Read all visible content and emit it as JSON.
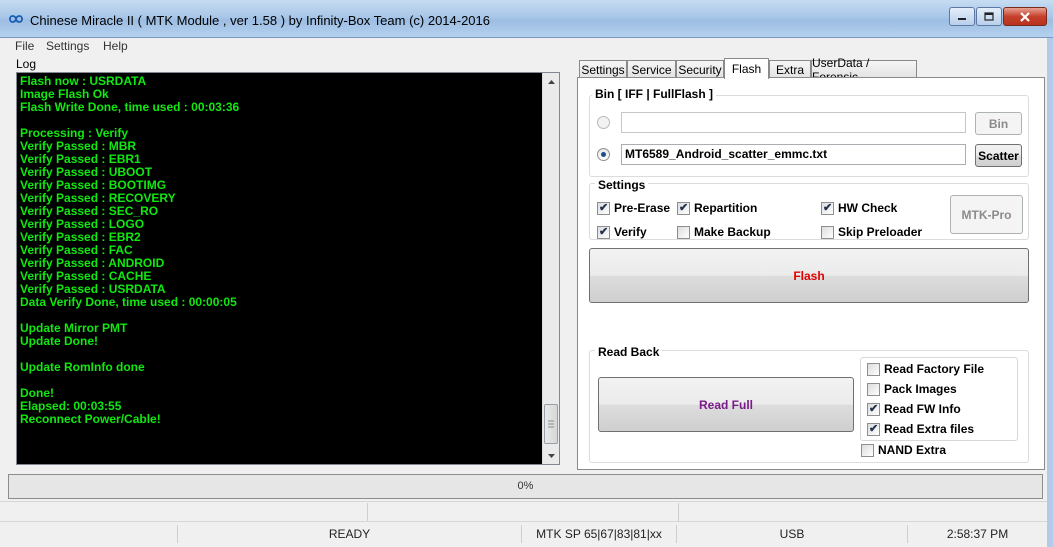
{
  "window": {
    "title": "Chinese Miracle II ( MTK Module , ver 1.58 ) by Infinity-Box Team (c) 2014-2016",
    "icon": "infinity-logo-icon"
  },
  "menu": [
    "File",
    "Settings",
    "Help"
  ],
  "log": {
    "label": "Log",
    "lines": [
      "Flash now : USRDATA",
      "Image Flash Ok",
      "Flash Write Done, time used : 00:03:36",
      "",
      "Processing : Verify",
      "Verify Passed : MBR",
      "Verify Passed : EBR1",
      "Verify Passed : UBOOT",
      "Verify Passed : BOOTIMG",
      "Verify Passed : RECOVERY",
      "Verify Passed : SEC_RO",
      "Verify Passed : LOGO",
      "Verify Passed : EBR2",
      "Verify Passed : FAC",
      "Verify Passed : ANDROID",
      "Verify Passed : CACHE",
      "Verify Passed : USRDATA",
      "Data Verify Done, time used : 00:00:05",
      "",
      "Update Mirror PMT",
      "Update Done!",
      "",
      "Update RomInfo done",
      "",
      "Done!",
      "Elapsed: 00:03:55",
      "Reconnect Power/Cable!"
    ]
  },
  "tabs": [
    "Settings",
    "Service",
    "Security",
    "Flash",
    "Extra",
    "UserData / Forensic"
  ],
  "active_tab": "Flash",
  "bin": {
    "title": "Bin  [ IFF | FullFlash ]",
    "bin_value": "",
    "bin_button": "Bin",
    "scatter_value": "MT6589_Android_scatter_emmc.txt",
    "scatter_button": "Scatter"
  },
  "settings": {
    "title": "Settings",
    "pre_erase": "Pre-Erase",
    "repartition": "Repartition",
    "hw_check": "HW Check",
    "verify": "Verify",
    "make_backup": "Make Backup",
    "skip_preloader": "Skip Preloader",
    "mtk_pro": "MTK-Pro"
  },
  "flash_button": "Flash",
  "readback": {
    "title": "Read Back",
    "read_full": "Read Full",
    "read_factory_file": "Read Factory File",
    "pack_images": "Pack Images",
    "read_fw_info": "Read FW Info",
    "read_extra_files": "Read Extra files",
    "nand_extra": "NAND Extra"
  },
  "progress": {
    "value": 0,
    "label": "0%"
  },
  "status": {
    "ready": "READY",
    "chip": "MTK SP 65|67|83|81|xx",
    "connection": "USB",
    "time": "2:58:37 PM"
  },
  "colors": {
    "log_bg": "#000000",
    "log_text": "#10e810",
    "flash_label": "#e00000",
    "read_full_label": "#7a1a8a"
  }
}
